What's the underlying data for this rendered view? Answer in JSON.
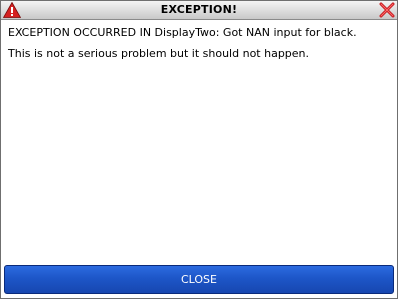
{
  "dialog": {
    "title": "EXCEPTION!",
    "message_line_1": "EXCEPTION OCCURRED IN DisplayTwo: Got NAN input for black.",
    "message_line_2": "This is not a serious problem but it should not happen.",
    "close_label": "CLOSE"
  },
  "icons": {
    "title_left": "warning-icon",
    "title_right": "close-icon"
  },
  "colors": {
    "button_blue": "#1d56c8",
    "warning_red": "#d42020",
    "close_x_red": "#c4161c"
  }
}
